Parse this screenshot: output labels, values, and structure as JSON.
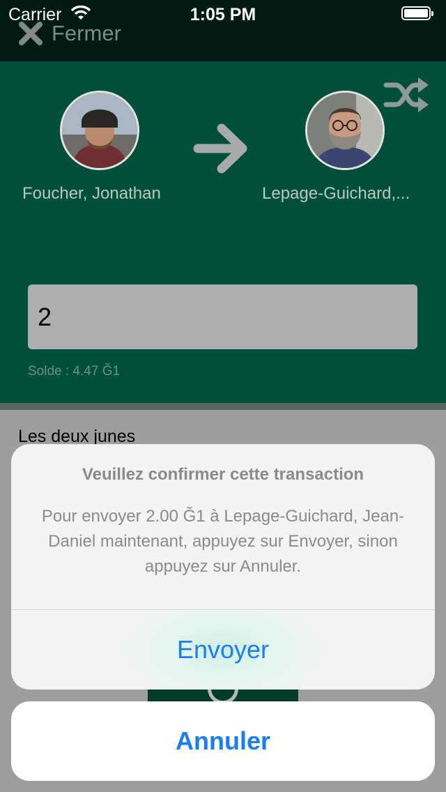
{
  "status_bar": {
    "carrier": "Carrier",
    "time": "1:05 PM"
  },
  "nav": {
    "close_label": "Fermer"
  },
  "transfer": {
    "from_name": "Foucher, Jonathan",
    "to_name": "Lepage-Guichard,...",
    "amount_value": "2",
    "balance_label": "Solde :  4.47 Ğ1",
    "comment": "Les deux junes"
  },
  "confirm_sheet": {
    "title": "Veuillez confirmer cette transaction",
    "message": "Pour envoyer 2.00 Ğ1 à Lepage-Guichard, Jean-Daniel maintenant, appuyez sur Envoyer, sinon appuyez sur Annuler.",
    "send_label": "Envoyer",
    "cancel_label": "Annuler"
  },
  "colors": {
    "panel_green": "#005039",
    "action_blue": "#1a7ef2"
  },
  "icons": [
    "wifi-icon",
    "battery-icon",
    "close-icon",
    "shuffle-icon",
    "arrow-right-icon"
  ]
}
